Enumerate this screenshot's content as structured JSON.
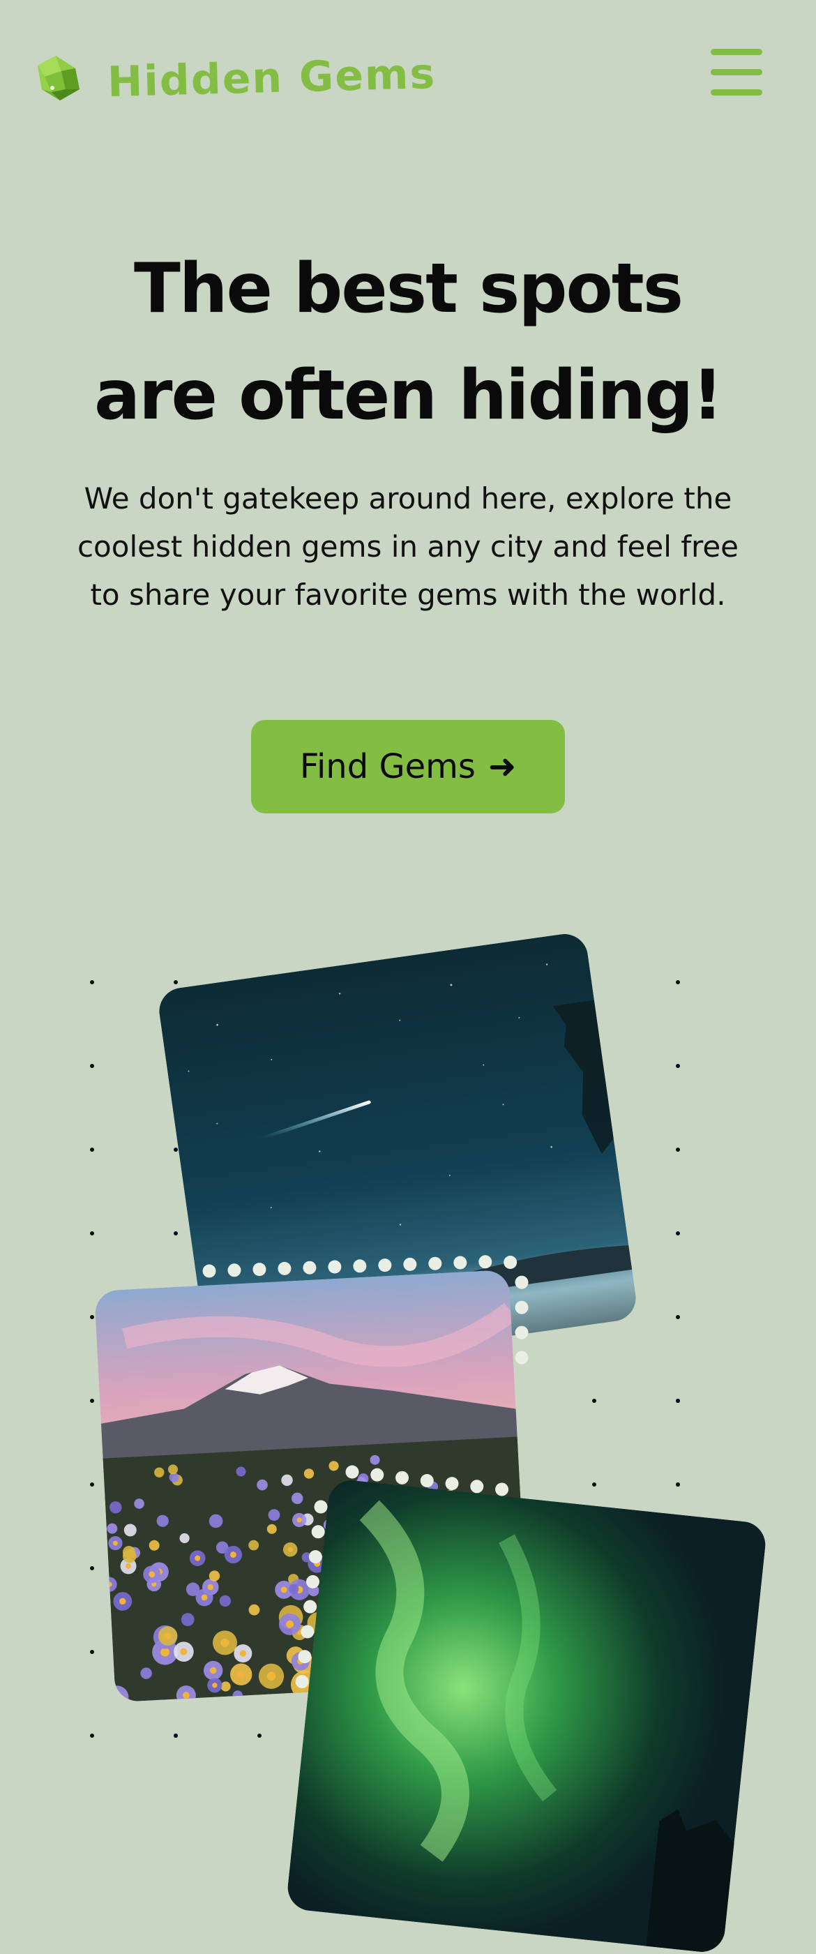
{
  "brand": {
    "name": "Hidden Gems",
    "accent": "#84bd43",
    "logo_icon": "gem-icon"
  },
  "header": {
    "menu_icon": "hamburger-menu-icon"
  },
  "hero": {
    "title_line1": "The best spots",
    "title_line2": "are often hiding!",
    "subtitle": "We don't gatekeep around here, explore the coolest hidden gems in any city and feel free to share your favorite gems with the world.",
    "cta_label": "Find Gems",
    "cta_icon": "arrow-right-icon",
    "cta_arrow": "➜"
  },
  "gallery": {
    "photos": [
      {
        "subject": "night-sky-shooting-star"
      },
      {
        "subject": "mountain-wildflower-meadow"
      },
      {
        "subject": "northern-lights"
      }
    ]
  },
  "colors": {
    "background": "#c9d6c4",
    "button": "#84bd43",
    "text": "#0d0d0d"
  }
}
